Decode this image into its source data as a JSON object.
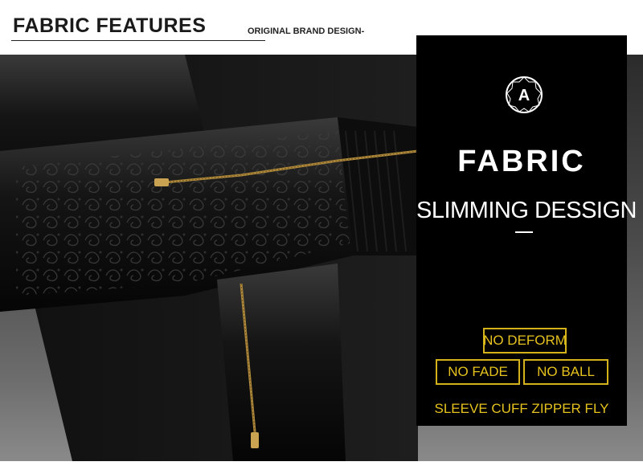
{
  "header": {
    "title": "FABRIC FEATURES",
    "brand_line": "ORIGINAL BRAND DESIGN-"
  },
  "panel": {
    "badge_letter": "A",
    "heading": "FABRIC",
    "subheading": "SLIMMING DESSIGN",
    "tags": [
      "NO DEFORM",
      "NO FADE",
      "NO BALL"
    ],
    "caption": "SLEEVE CUFF ZIPPER FLY"
  },
  "colors": {
    "accent_gold": "#e6c21e",
    "panel_bg": "#000000"
  }
}
